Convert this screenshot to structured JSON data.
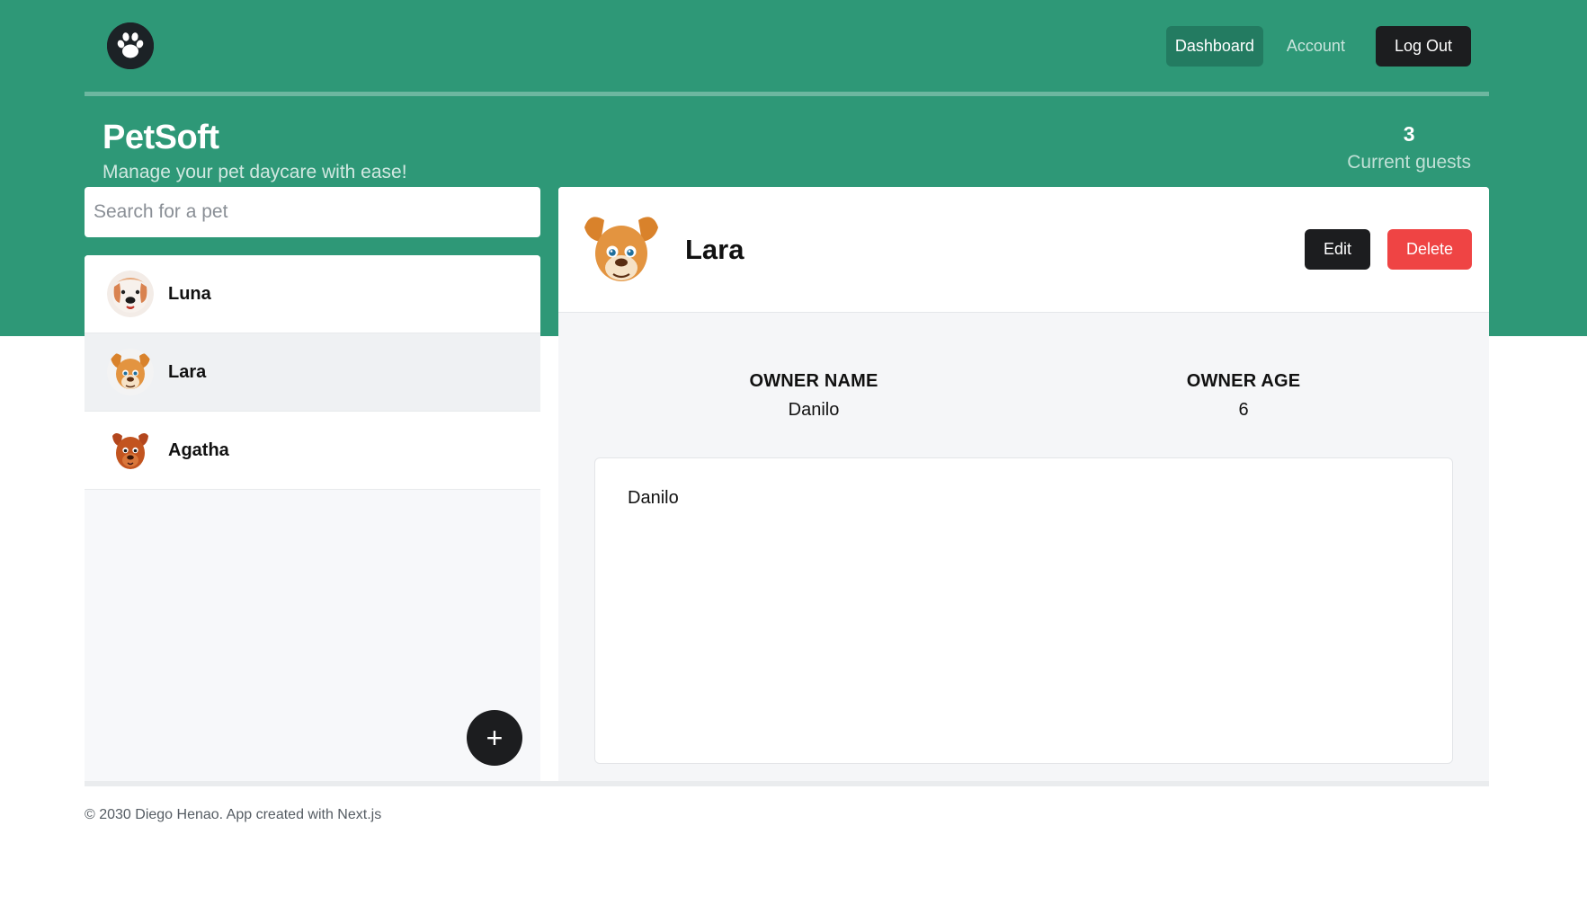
{
  "brand": {
    "title": "PetSoft",
    "subtitle": "Manage your pet daycare with ease!"
  },
  "nav": {
    "items": [
      {
        "label": "Dashboard",
        "active": true
      },
      {
        "label": "Account",
        "active": false
      }
    ],
    "logout_label": "Log Out"
  },
  "stats": {
    "count": "3",
    "label": "Current guests"
  },
  "search": {
    "placeholder": "Search for a pet",
    "value": ""
  },
  "pets": [
    {
      "name": "Luna",
      "icon": "dog-avatar-icon",
      "selected": false
    },
    {
      "name": "Lara",
      "icon": "dog-avatar-icon",
      "selected": true
    },
    {
      "name": "Agatha",
      "icon": "dog-avatar-icon",
      "selected": false
    }
  ],
  "add_button": {
    "label": "+"
  },
  "detail": {
    "name": "Lara",
    "edit_label": "Edit",
    "delete_label": "Delete",
    "owner_name_label": "OWNER NAME",
    "owner_name": "Danilo",
    "owner_age_label": "OWNER AGE",
    "owner_age": "6",
    "notes": "Danilo"
  },
  "footer": {
    "text": "© 2030 Diego Henao. App created with Next.js"
  },
  "colors": {
    "brand_green": "#2e9877",
    "nav_active": "#237b61",
    "dark_button": "#1c1d1f",
    "danger": "#ef4444"
  }
}
